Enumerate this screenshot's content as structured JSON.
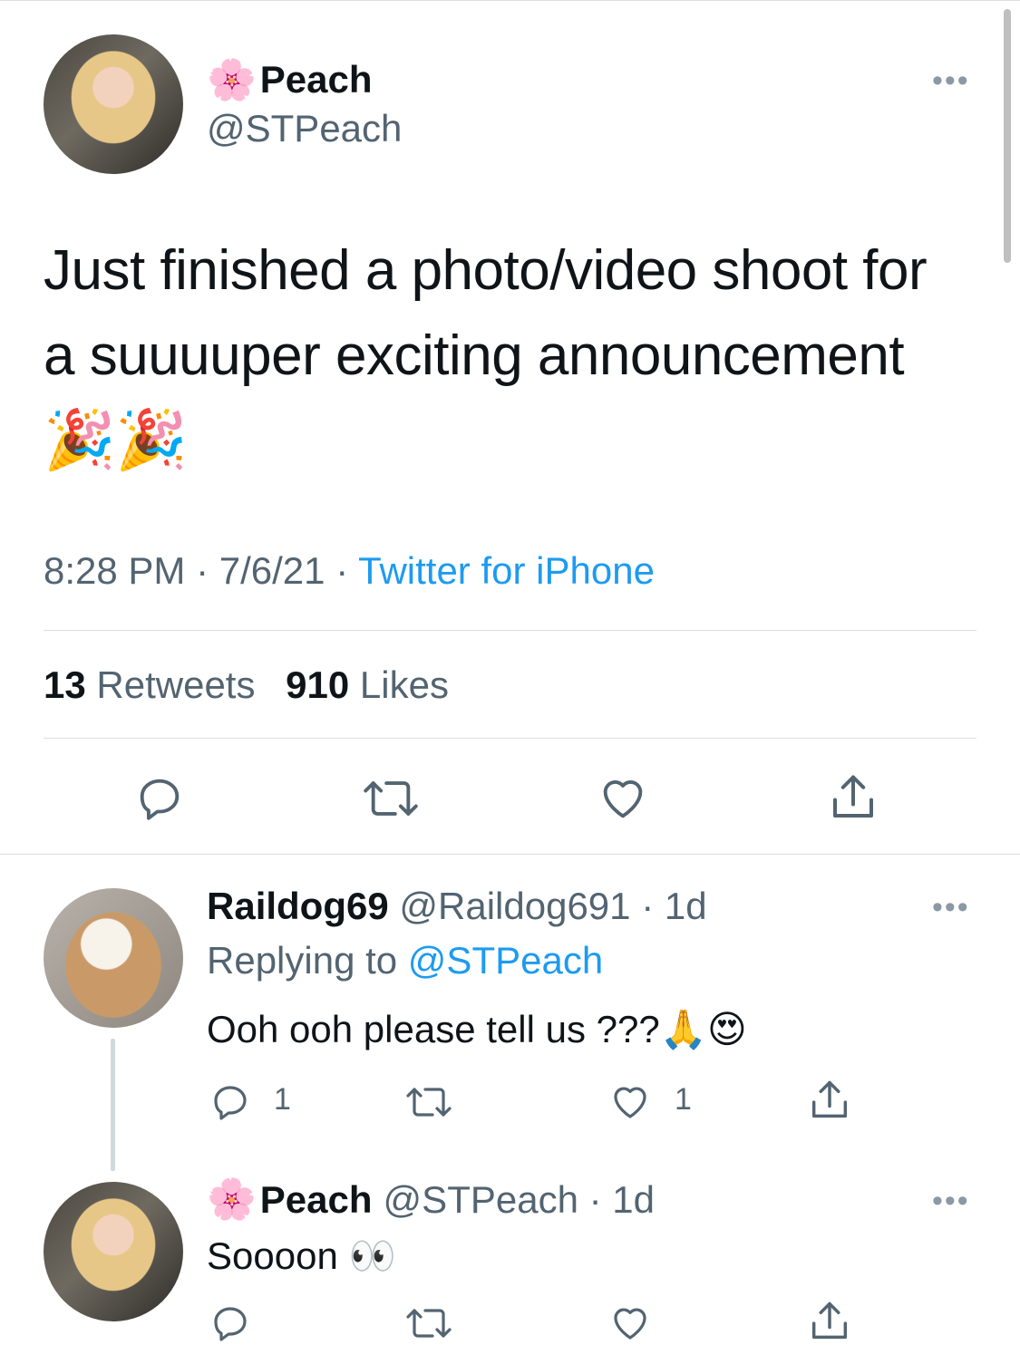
{
  "main_tweet": {
    "flower_emoji": "🌸",
    "author_name": "Peach",
    "author_handle": "@STPeach",
    "text_line1": "Just finished a photo/video shoot for",
    "text_line2": "a suuuuper exciting announcement",
    "emoji_line": "🎉🎉",
    "time": "8:28 PM",
    "sep1": " · ",
    "date": "7/6/21",
    "sep2": " · ",
    "source": "Twitter for iPhone",
    "retweets_count": "13",
    "retweets_label": "Retweets",
    "likes_count": "910",
    "likes_label": "Likes",
    "more_glyph": "•••"
  },
  "reply1": {
    "author_name": "Raildog69",
    "author_handle": "@Raildog691",
    "time_sep": " · ",
    "time": "1d",
    "replying_prefix": "Replying to ",
    "replying_handle": "@STPeach",
    "text": "Ooh ooh please tell us ???🙏😍",
    "reply_count": "1",
    "like_count": "1",
    "more_glyph": "•••"
  },
  "reply2": {
    "flower_emoji": "🌸",
    "author_name": "Peach",
    "author_handle": "@STPeach",
    "time_sep": " · ",
    "time": "1d",
    "text": "Soooon 👀",
    "more_glyph": "•••"
  },
  "colors": {
    "link_blue": "#1d9bf0",
    "secondary_text": "#536471",
    "divider": "#dcdfe2"
  }
}
